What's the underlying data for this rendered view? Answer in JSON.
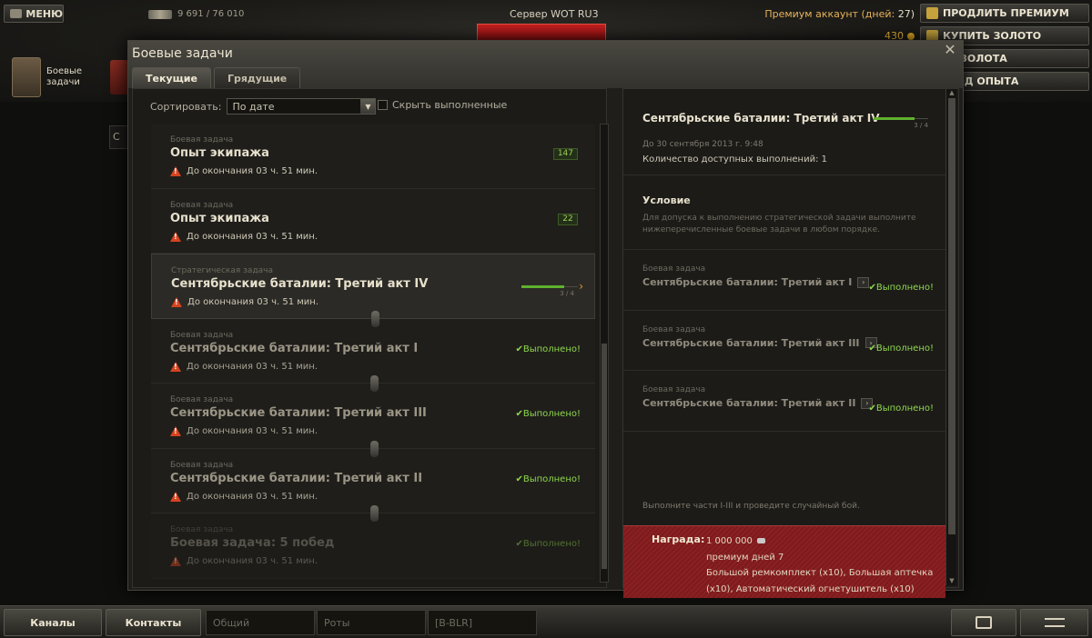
{
  "topbar": {
    "menu_label": "МЕНЮ",
    "stats_text": "9 691 / 76 010",
    "server": "Сервер WOT RU3",
    "premium_label": "Премиум аккаунт (дней:",
    "premium_days": "27)",
    "gold": "430",
    "buttons": [
      "ПРОДЛИТЬ ПРЕМИУМ",
      "КУПИТЬ ЗОЛОТО",
      "Н ЗОЛОТА",
      "ВОД ОПЫТА"
    ],
    "left_tile_label_1": "Боевые",
    "left_tile_label_2": "задачи",
    "side_fragment": "С"
  },
  "dialog": {
    "title": "Боевые задачи",
    "tabs": [
      "Текущие",
      "Грядущие"
    ],
    "sort_label": "Сортировать:",
    "sort_value": "По дате",
    "hide_done_label": "Скрыть выполненные",
    "quests": [
      {
        "kind": "Боевая задача",
        "title": "Опыт экипажа",
        "time": "До окончания 03 ч. 51 мин.",
        "badge": "147",
        "status": ""
      },
      {
        "kind": "Боевая задача",
        "title": "Опыт экипажа",
        "time": "До окончания 03 ч. 51 мин.",
        "badge": "22",
        "status": ""
      },
      {
        "kind": "Стратегическая задача",
        "title": "Сентябрьские баталии: Третий акт IV",
        "time": "До окончания 03 ч. 51 мин.",
        "badge": "",
        "status": "",
        "progress": 0.75,
        "progress_text": "3 / 4"
      },
      {
        "kind": "Боевая задача",
        "title": "Сентябрьские баталии: Третий акт I",
        "time": "До окончания 03 ч. 51 мин.",
        "badge": "",
        "status": "✔Выполнено!"
      },
      {
        "kind": "Боевая задача",
        "title": "Сентябрьские баталии: Третий акт III",
        "time": "До окончания 03 ч. 51 мин.",
        "badge": "",
        "status": "✔Выполнено!"
      },
      {
        "kind": "Боевая задача",
        "title": "Сентябрьские баталии: Третий акт II",
        "time": "До окончания 03 ч. 51 мин.",
        "badge": "",
        "status": "✔Выполнено!"
      },
      {
        "kind": "Боевая задача",
        "title": "Боевая задача: 5 побед",
        "time": "До окончания 03 ч. 51 мин.",
        "badge": "",
        "status": "✔Выполнено!"
      }
    ],
    "detail": {
      "title": "Сентябрьские баталии: Третий акт IV",
      "progress": 0.75,
      "progress_text": "3 / 4",
      "date": "До 30 сентября 2013 г. 9:48",
      "count": "Количество доступных выполнений: 1",
      "condition_title": "Условие",
      "condition_text": "Для допуска к выполнению стратегической задачи выполните нижеперечисленные боевые задачи в любом порядке.",
      "subquests": [
        {
          "kind": "Боевая задача",
          "title": "Сентябрьские баталии: Третий акт I",
          "status": "✔Выполнено!"
        },
        {
          "kind": "Боевая задача",
          "title": "Сентябрьские баталии: Третий акт III",
          "status": "✔Выполнено!"
        },
        {
          "kind": "Боевая задача",
          "title": "Сентябрьские баталии: Третий акт II",
          "status": "✔Выполнено!"
        }
      ],
      "note": "Выполните части I-III и проведите случайный бой.",
      "reward_label": "Награда:",
      "reward_lines": [
        "1 000 000",
        "премиум дней 7",
        "Большой ремкомплект (x10), Большая аптечка",
        "(x10), Автоматический огнетушитель (x10)"
      ]
    }
  },
  "bottombar": {
    "channels": "Каналы",
    "contacts": "Контакты",
    "chan_general": "Общий",
    "chan_companies": "Роты",
    "chan_clan": "[B-BLR]"
  },
  "colors": {
    "accent_green": "#8fd74d",
    "warning": "#d6431f",
    "reward_bg": "#7c1b1d",
    "gold": "#f1c13a"
  }
}
